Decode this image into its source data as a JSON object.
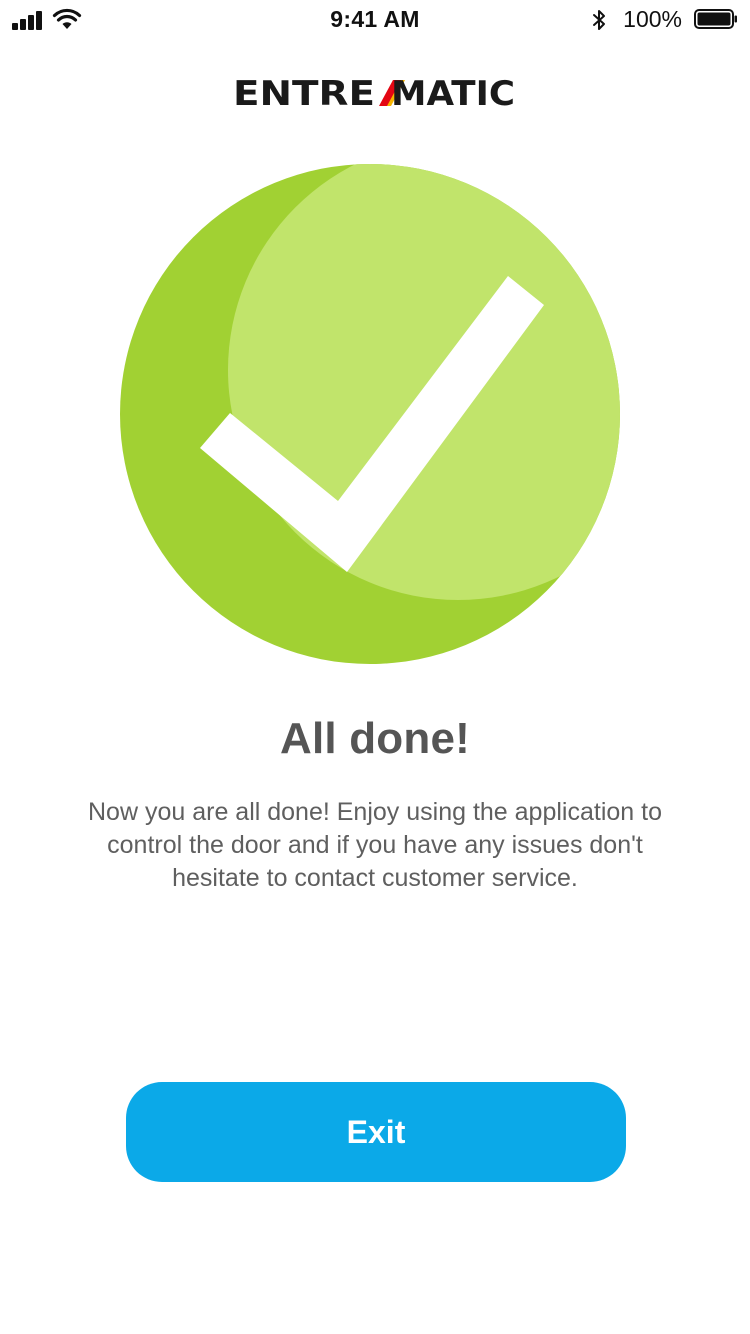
{
  "status_bar": {
    "time": "9:41 AM",
    "battery_percent": "100%",
    "icons": [
      "signal-icon",
      "wifi-icon",
      "bluetooth-icon",
      "battery-icon"
    ],
    "battery_level": 1.0
  },
  "brand": {
    "name": "ENTREMATIC",
    "logo_icon": "entrematic-logo"
  },
  "illustration": {
    "icon": "checkmark-icon",
    "colors": {
      "circle_dark": "#a1d133",
      "circle_light": "#c1e46b",
      "check": "#ffffff"
    }
  },
  "content": {
    "title": "All done!",
    "message": "Now you are all done! Enjoy using the application to control the door and if you have any issues don't hesitate to contact customer service."
  },
  "actions": {
    "exit_label": "Exit",
    "exit_color": "#0ba9e8"
  }
}
